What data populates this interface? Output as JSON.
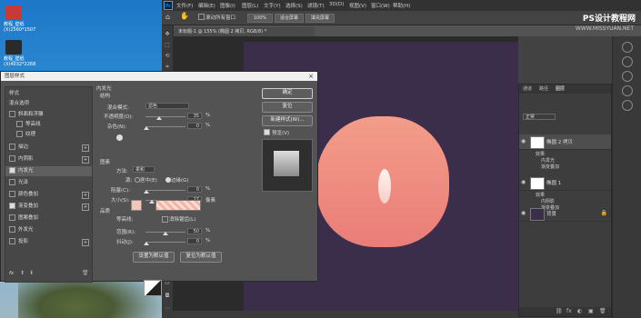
{
  "desktop": {
    "icons": [
      {
        "label": "教程_壁纸\n(X)2560*1507"
      },
      {
        "label": "教程_壁纸\n(X)4032*2268"
      }
    ]
  },
  "photoshop": {
    "logo": "Ps",
    "menu": [
      "文件(F)",
      "编辑(E)",
      "图像(I)",
      "图层(L)",
      "文字(Y)",
      "选择(S)",
      "滤镜(T)",
      "3D(D)",
      "视图(V)",
      "窗口(W)",
      "帮助(H)"
    ],
    "options": {
      "scroll_all": "滚动所有窗口",
      "zoom": "100%",
      "fit_screen": "适合屏幕",
      "fill_screen": "填充屏幕"
    },
    "watermark": "PS设计教程网",
    "watermark2": "WWW.MISSYUAN.NET",
    "doc_tab": "未标题-1 @ 155% (椭圆 2 拷贝, RGB/8) *",
    "layers_panel": {
      "tabs": [
        "通道",
        "路径",
        "图层"
      ],
      "active_tab": "图层",
      "kind": "正常",
      "layers": [
        {
          "name": "椭圆 2 拷贝",
          "effects_title": "效果",
          "effects": [
            "内发光",
            "渐变叠加"
          ]
        },
        {
          "name": "椭圆 1",
          "effects_title": "效果",
          "effects": [
            "内阴影",
            "渐变叠加"
          ]
        },
        {
          "name": "背景"
        }
      ]
    },
    "colors": {
      "canvas": "#3b2e4a",
      "shape_top": "#f39d8a",
      "shape_bottom": "#ea7d78"
    }
  },
  "dialog": {
    "title": "图层样式",
    "close": "×",
    "styles_header": "样式",
    "blend_options": "混合选项",
    "items": [
      {
        "label": "斜面和浮雕",
        "checked": false
      },
      {
        "label": "等高线",
        "checked": false
      },
      {
        "label": "纹理",
        "checked": false
      },
      {
        "label": "描边",
        "checked": false,
        "plus": true
      },
      {
        "label": "内阴影",
        "checked": false,
        "plus": true
      },
      {
        "label": "内发光",
        "checked": true,
        "active": true
      },
      {
        "label": "光泽",
        "checked": false
      },
      {
        "label": "颜色叠加",
        "checked": false,
        "plus": true
      },
      {
        "label": "渐变叠加",
        "checked": true,
        "plus": true
      },
      {
        "label": "图案叠加",
        "checked": false
      },
      {
        "label": "外发光",
        "checked": false
      },
      {
        "label": "投影",
        "checked": false,
        "plus": true
      }
    ],
    "fx": "fx",
    "section_title": "内发光",
    "structure": {
      "title": "结构",
      "blend_mode_label": "混合模式:",
      "blend_mode": "滤色",
      "opacity_label": "不透明度(O):",
      "opacity": "35",
      "noise_label": "杂色(N):",
      "noise": "0",
      "percent": "%"
    },
    "elements": {
      "title": "图素",
      "method_label": "方法:",
      "method": "柔和",
      "source_label": "源:",
      "center": "居中(E)",
      "edge": "边缘(G)",
      "choke_label": "阻塞(C):",
      "choke": "0",
      "size_label": "大小(S):",
      "size": "27",
      "px": "像素"
    },
    "quality": {
      "title": "品质",
      "contour_label": "等高线:",
      "antialias": "消除锯齿(L)",
      "range_label": "范围(R):",
      "range": "50",
      "jitter_label": "抖动(J):",
      "jitter": "0"
    },
    "buttons": {
      "ok": "确定",
      "reset": "复位",
      "new_style": "新建样式(W)...",
      "preview": "预览(V)",
      "make_default": "设置为默认值",
      "reset_default": "复位为默认值"
    }
  }
}
